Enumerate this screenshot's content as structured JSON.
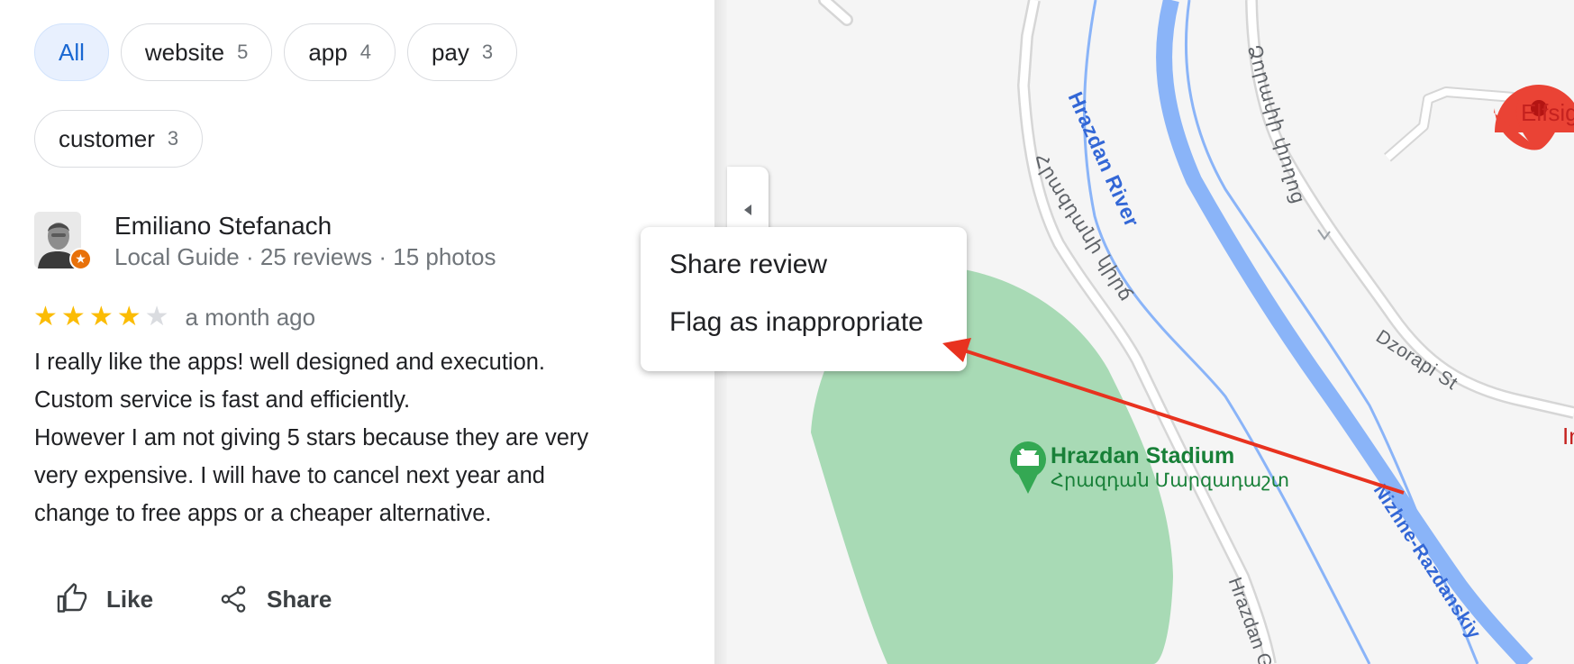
{
  "filters": [
    {
      "label": "All",
      "count": "",
      "selected": true
    },
    {
      "label": "website",
      "count": "5"
    },
    {
      "label": "app",
      "count": "4"
    },
    {
      "label": "pay",
      "count": "3"
    },
    {
      "label": "customer",
      "count": "3"
    }
  ],
  "review": {
    "author": "Emiliano Stefanach",
    "meta": "Local Guide · 25 reviews · 15 photos",
    "rating": 4,
    "rating_max": 5,
    "date": "a month ago",
    "lines": [
      "I really like the apps! well designed and execution.",
      "Custom service is fast and efficiently.",
      "However I am not giving 5 stars because they are very",
      "very expensive. I will have to cancel next year and",
      "change to free apps or a cheaper alternative."
    ]
  },
  "actions": {
    "like": "Like",
    "share": "Share"
  },
  "menu": {
    "share_review": "Share review",
    "flag": "Flag as inappropriate"
  },
  "map": {
    "river": "Hrazdan River",
    "road_hrazdan_hy": "Հրազդանի կիրճ",
    "road_dzorapi_hy": "Ձորափի փողոց",
    "road_dzorapi": "Dzorapi St",
    "road_nizhne": "Nizhne-Razdanskiy",
    "road_hrazdan_gorge": "Hrazdan Go",
    "stadium_name": "Hrazdan Stadium",
    "stadium_name_hy": "Հրազդան Մարզադաշտ",
    "pin_label": "Elfsig",
    "edge_label": "In",
    "colors": {
      "park": "#a8dab5",
      "river": "#8ab4f8",
      "pin": "#ea4335",
      "arrow": "#e8321f"
    }
  }
}
